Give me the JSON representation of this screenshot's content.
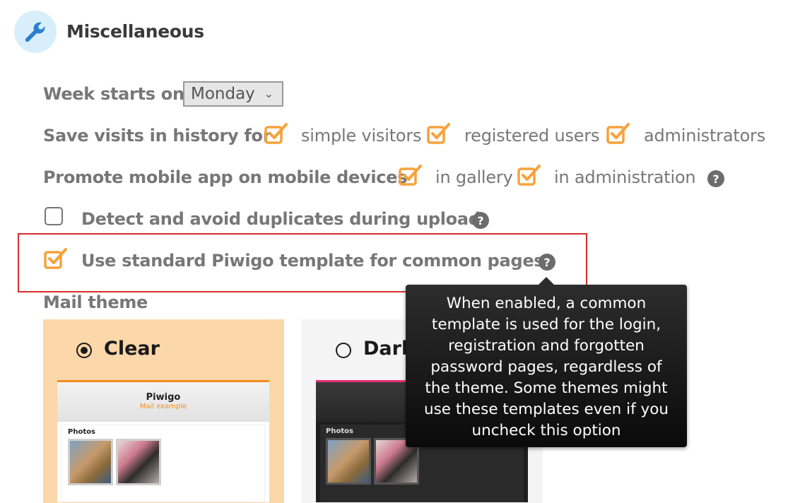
{
  "section": {
    "title": "Miscellaneous",
    "icon": "wrench-icon"
  },
  "week_start": {
    "label": "Week starts on",
    "value": "Monday"
  },
  "history": {
    "label": "Save visits in history for",
    "options": [
      {
        "label": "simple visitors",
        "checked": true
      },
      {
        "label": "registered users",
        "checked": true
      },
      {
        "label": "administrators",
        "checked": true
      }
    ]
  },
  "mobile": {
    "label": "Promote mobile app on mobile devices",
    "options": [
      {
        "label": "in gallery",
        "checked": true
      },
      {
        "label": "in administration",
        "checked": true
      }
    ]
  },
  "duplicates": {
    "label": "Detect and avoid duplicates during upload",
    "checked": false
  },
  "standard_template": {
    "label": "Use standard Piwigo template for common pages.",
    "checked": true
  },
  "mail_theme": {
    "label": "Mail theme",
    "themes": [
      {
        "name": "Clear",
        "selected": true
      },
      {
        "name": "Dark",
        "selected": false
      }
    ],
    "preview": {
      "site_title": "Piwigo",
      "subtitle": "Mail example",
      "photos_label": "Photos"
    }
  },
  "tooltip": {
    "text": "When enabled, a common template is used for the login, registration and forgotten password pages, regardless of the theme. Some themes might use these templates even if you uncheck this option"
  },
  "colors": {
    "accent": "#f7a23b",
    "highlight_border": "#d62e2e",
    "icon_bg": "#d8eefb",
    "icon_fg": "#2b7fd0"
  }
}
